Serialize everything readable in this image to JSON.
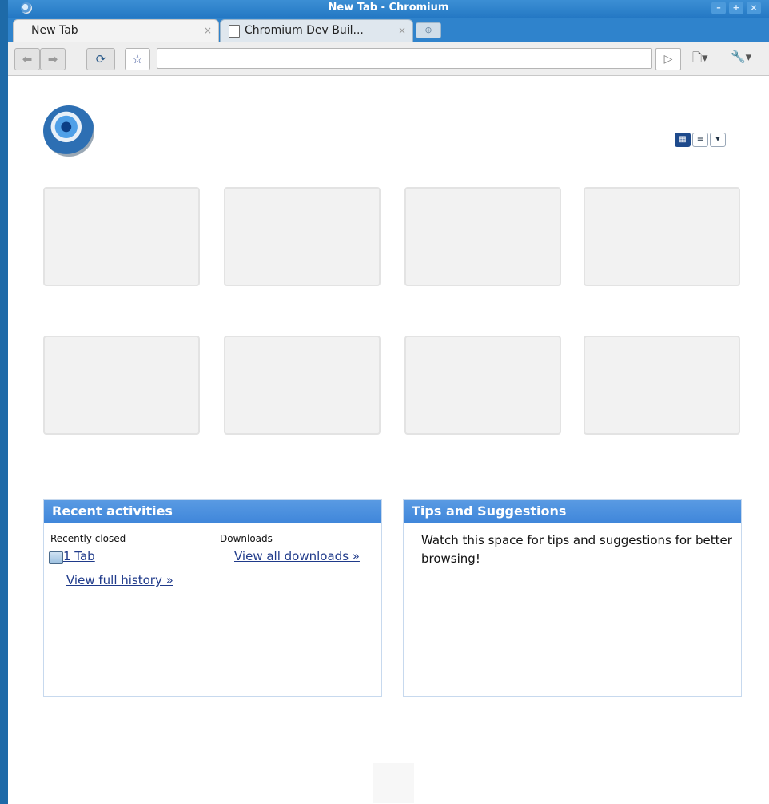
{
  "window": {
    "title": "New Tab - Chromium",
    "controls": {
      "minimize": "–",
      "maximize": "+",
      "close": "×"
    }
  },
  "tabs": [
    {
      "label": "New Tab",
      "close": "×",
      "active": true
    },
    {
      "label": "Chromium Dev Buil...",
      "close": "×",
      "active": false
    }
  ],
  "toolbar": {
    "back_icon": "back-arrow-icon",
    "forward_icon": "forward-arrow-icon",
    "reload_icon": "reload-icon",
    "star_icon": "star-icon",
    "address_value": "",
    "go_icon": "play-icon",
    "page_menu_icon": "page-menu-icon",
    "wrench_menu_icon": "wrench-icon"
  },
  "view_toggles": [
    "grid-view-icon",
    "list-view-icon",
    "dropdown-icon"
  ],
  "thumbnails": {
    "count": 8
  },
  "recent_activities": {
    "title": "Recent activities",
    "recently_closed_label": "Recently closed",
    "closed_item": "1 Tab",
    "view_history": "View full history »",
    "downloads_label": "Downloads",
    "view_downloads": "View all downloads »"
  },
  "tips": {
    "title": "Tips and Suggestions",
    "text": "Watch this space for tips and suggestions for better browsing!"
  },
  "colors": {
    "title_bar": "#2f83cc",
    "panel_header": "#4a90e2",
    "link": "#1f3a8a"
  }
}
